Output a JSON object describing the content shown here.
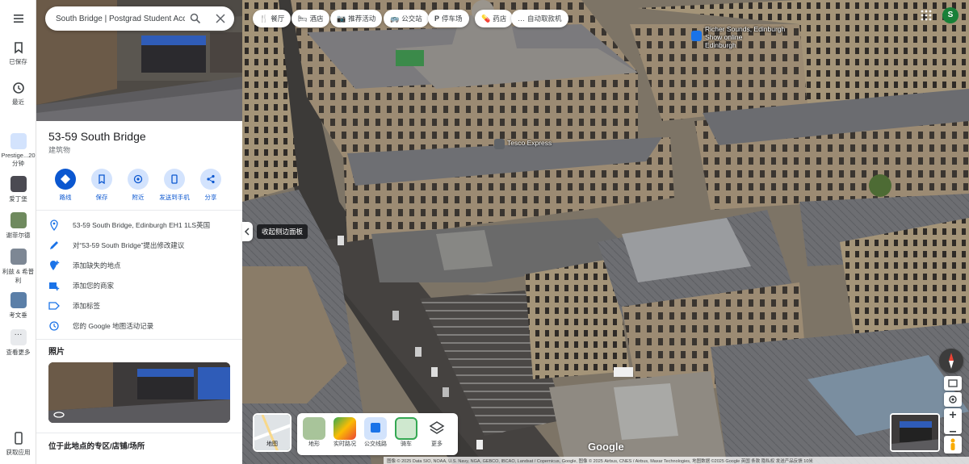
{
  "search": {
    "value": "South Bridge | Postgrad Student Acc"
  },
  "rail": {
    "saved": "已保存",
    "recent": "最近",
    "recents": [
      {
        "label": "Prestige...20分钟"
      },
      {
        "label": "爱丁堡"
      },
      {
        "label": "谢菲尔德"
      },
      {
        "label": "利兹 & 希普利"
      },
      {
        "label": "考文垂"
      }
    ],
    "more": "查看更多",
    "get_app": "获取应用"
  },
  "place": {
    "name": "53-59 South Bridge",
    "category": "建筑物",
    "actions": [
      {
        "label": "路线",
        "icon": "directions-icon"
      },
      {
        "label": "保存",
        "icon": "bookmark-icon"
      },
      {
        "label": "附近",
        "icon": "nearby-icon"
      },
      {
        "label": "发送到手机",
        "icon": "phone-icon"
      },
      {
        "label": "分享",
        "icon": "share-icon"
      }
    ],
    "details": [
      {
        "text": "53-59 South Bridge, Edinburgh EH1 1LS英国",
        "icon": "location-pin-icon"
      },
      {
        "text": "对“53-59 South Bridge”提出修改建议",
        "icon": "pencil-icon"
      },
      {
        "text": "添加缺失的地点",
        "icon": "add-place-icon"
      },
      {
        "text": "添加您的商家",
        "icon": "add-business-icon"
      },
      {
        "text": "添加标签",
        "icon": "label-icon"
      },
      {
        "text": "您的 Google 地图活动记录",
        "icon": "history-icon"
      }
    ],
    "photos_heading": "照片",
    "bottom_heading": "位于此地点的专区/店铺/场所"
  },
  "collapse_tooltip": "收起侧边面板",
  "chips": [
    {
      "label": "餐厅",
      "icon": "restaurant-icon",
      "glyph": "🍴"
    },
    {
      "label": "酒店",
      "icon": "hotel-icon",
      "glyph": "🛏"
    },
    {
      "label": "推荐活动",
      "icon": "camera-icon",
      "glyph": "📷"
    },
    {
      "label": "公交站",
      "icon": "bus-icon",
      "glyph": "🚌"
    },
    {
      "label": "停车场",
      "icon": "parking-icon",
      "glyph": "P"
    },
    {
      "label": "药店",
      "icon": "pharmacy-icon",
      "glyph": "💊"
    },
    {
      "label": "自动取款机",
      "icon": "atm-icon",
      "glyph": "…"
    }
  ],
  "avatar_letter": "S",
  "map_labels": {
    "richer_sounds_1": "Richer Sounds, Edinburgh",
    "richer_sounds_2": "Show online",
    "richer_sounds_3": "Edinburgh",
    "tesco": "Tesco Express"
  },
  "layers": {
    "current": "地图",
    "items": [
      {
        "label": "地形"
      },
      {
        "label": "实时路况"
      },
      {
        "label": "公交线路"
      },
      {
        "label": "骑车"
      },
      {
        "label": "更多"
      }
    ]
  },
  "google_logo": "Google",
  "attribution": "图像 © 2025 Data SIO, NOAA, U.S. Navy, NGA, GEBCO, IBCAO, Landsat / Copernicus, Google, 图像 © 2025 Airbus, CNES / Airbus, Maxar Technologies, 地图数据 ©2025 Google 英国 条款 隐私权 发送产品反馈 10米"
}
